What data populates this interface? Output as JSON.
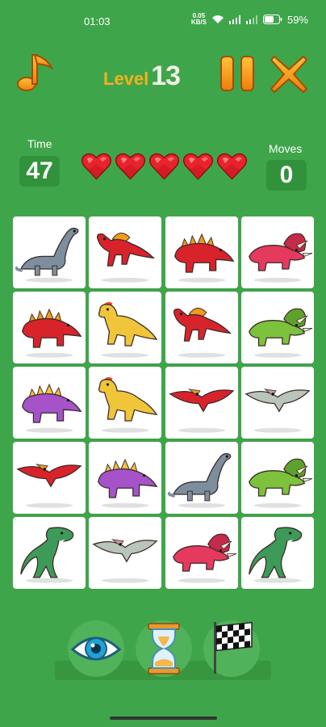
{
  "status_bar": {
    "time": "01:03",
    "net_speed_value": "0.05",
    "net_speed_unit": "KB/S",
    "battery_percent": "59%"
  },
  "header": {
    "level_word": "Level",
    "level_number": "13"
  },
  "stats": {
    "time_label": "Time",
    "time_value": "47",
    "moves_label": "Moves",
    "moves_value": "0",
    "hearts": 5
  },
  "board": {
    "rows": 5,
    "cols": 4,
    "tiles": [
      [
        "gray-brontosaurus",
        "red-spinosaurus",
        "red-stegosaurus",
        "pink-triceratops"
      ],
      [
        "red-stegosaurus",
        "yellow-dilophosaurus",
        "red-spinosaurus",
        "green-triceratops"
      ],
      [
        "purple-stegosaurus",
        "yellow-dilophosaurus",
        "red-pterodactyl",
        "gray-pterodactyl"
      ],
      [
        "red-pterodactyl",
        "purple-stegosaurus",
        "gray-brontosaurus",
        "green-triceratops"
      ],
      [
        "green-trex",
        "gray-pterodactyl",
        "pink-triceratops",
        "green-trex"
      ]
    ]
  },
  "colors": {
    "background": "#3fa54a",
    "level_word": "#f4b21b",
    "button_orange": "#f59a17",
    "heart": "#e8232e"
  },
  "powerups": [
    "eye-reveal",
    "hourglass-time",
    "finish-flag"
  ]
}
